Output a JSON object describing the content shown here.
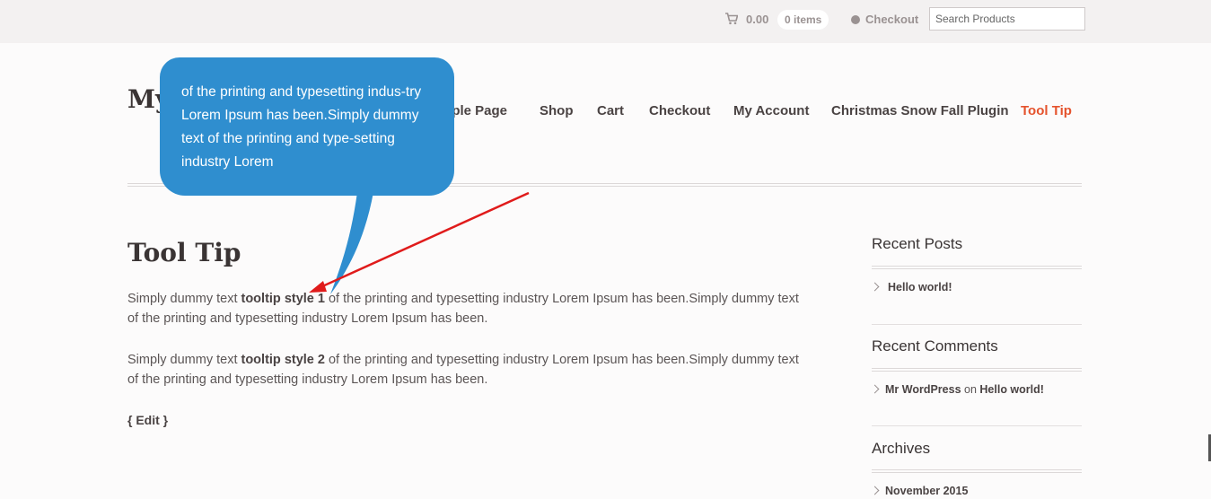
{
  "topbar": {
    "cart_amount": "0.00",
    "cart_items": "0 items",
    "checkout_label": "Checkout",
    "search_placeholder": "Search Products"
  },
  "site": {
    "title": "My"
  },
  "nav": {
    "items": [
      {
        "label": "mple Page"
      },
      {
        "label": "Shop"
      },
      {
        "label": "Cart"
      },
      {
        "label": "Checkout"
      },
      {
        "label": "My Account"
      },
      {
        "label": "Christmas Snow Fall Plugin"
      },
      {
        "label": "Tool Tip"
      }
    ]
  },
  "page": {
    "title": "Tool Tip",
    "paragraphs": [
      {
        "before": "Simply dummy text ",
        "link": "tooltip style 1",
        "after": " of the printing and typesetting industry Lorem Ipsum has been.Simply dummy text of the printing and typesetting industry Lorem Ipsum has been."
      },
      {
        "before": "Simply dummy text ",
        "link": "tooltip style 2",
        "after": " of the printing and typesetting industry Lorem Ipsum has been.Simply dummy text of the printing and typesetting industry Lorem Ipsum has been."
      }
    ],
    "edit_label": "{ Edit }"
  },
  "tooltip": {
    "text": "of the printing and typesetting indus-try Lorem Ipsum has been.Simply dummy text of the printing and type-setting industry Lorem",
    "background": "#2f8ecf"
  },
  "sidebar": {
    "recent_posts": {
      "title": "Recent Posts",
      "items": [
        "Hello world!"
      ]
    },
    "recent_comments": {
      "title": "Recent Comments",
      "author": "Mr WordPress",
      "on_word": "on",
      "post": "Hello world!"
    },
    "archives": {
      "title": "Archives",
      "items": [
        "November 2015"
      ]
    }
  },
  "colors": {
    "accent": "#e5532d",
    "annotation_arrow": "#e01b1b"
  }
}
